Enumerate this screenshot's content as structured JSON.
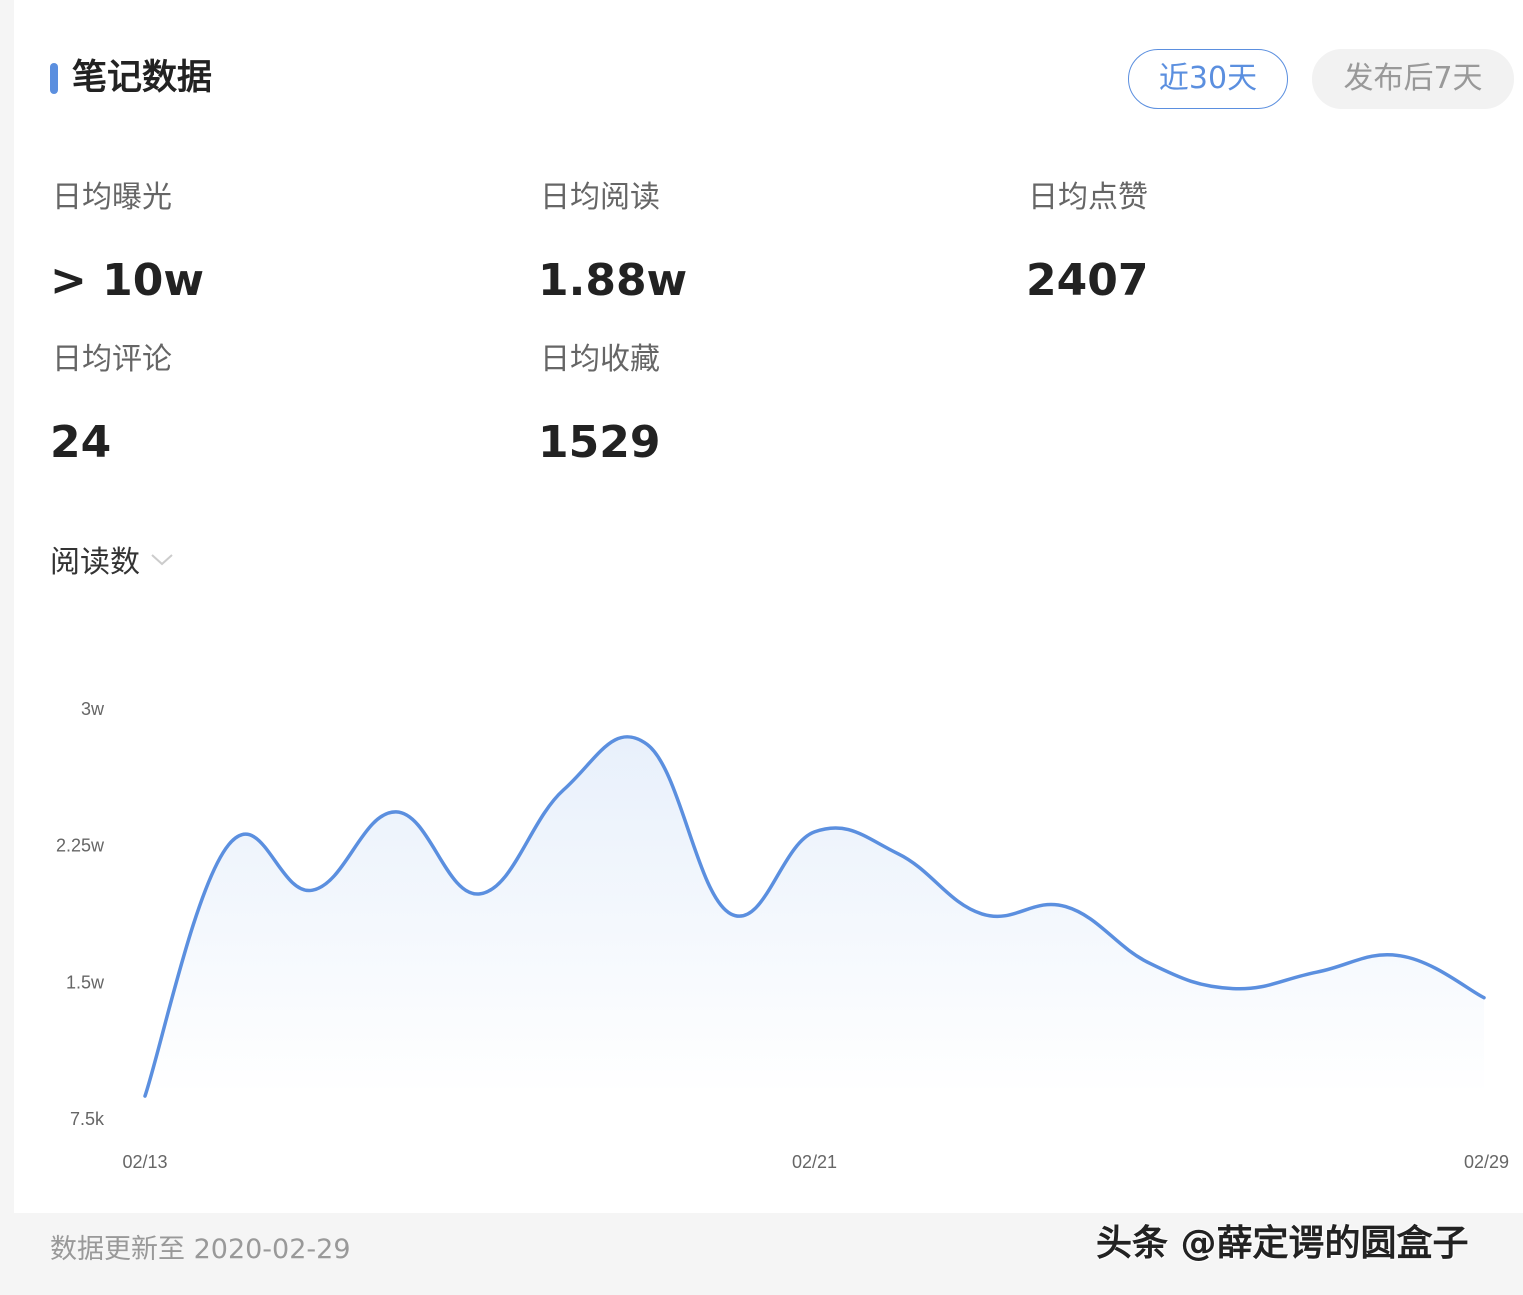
{
  "header": {
    "title": "笔记数据",
    "accent_color": "#5b8fdf"
  },
  "tabs": [
    {
      "label": "近30天",
      "active": true
    },
    {
      "label": "发布后7天",
      "active": false
    }
  ],
  "stats": [
    {
      "label": "日均曝光",
      "value": "> 10w"
    },
    {
      "label": "日均阅读",
      "value": "1.88w"
    },
    {
      "label": "日均点赞",
      "value": "2407"
    },
    {
      "label": "日均评论",
      "value": "24"
    },
    {
      "label": "日均收藏",
      "value": "1529"
    }
  ],
  "metric_selector": {
    "label": "阅读数",
    "icon": "chevron-down-icon"
  },
  "chart_data": {
    "type": "area",
    "x": [
      "02/13",
      "02/14",
      "02/15",
      "02/16",
      "02/17",
      "02/18",
      "02/19",
      "02/20",
      "02/21",
      "02/22",
      "02/23",
      "02/24",
      "02/25",
      "02/26",
      "02/27",
      "02/28",
      "02/29"
    ],
    "values": [
      8700,
      22500,
      20000,
      24300,
      19800,
      25500,
      28000,
      18700,
      23200,
      22000,
      18700,
      19100,
      16000,
      14600,
      15500,
      16400,
      14100
    ],
    "yticks": [
      {
        "value": 7500,
        "label": "7.5k"
      },
      {
        "value": 15000,
        "label": "1.5w"
      },
      {
        "value": 22500,
        "label": "2.25w"
      },
      {
        "value": 30000,
        "label": "3w"
      }
    ],
    "xticks": [
      "02/13",
      "02/21",
      "02/29"
    ],
    "ylim": [
      7500,
      30000
    ],
    "line_color": "#5b8fdf",
    "fill_color": "#eaf1fb",
    "grid": false
  },
  "footer": {
    "update_text": "数据更新至 2020-02-29",
    "watermark": "头条 @薛定谔的圆盒子"
  }
}
